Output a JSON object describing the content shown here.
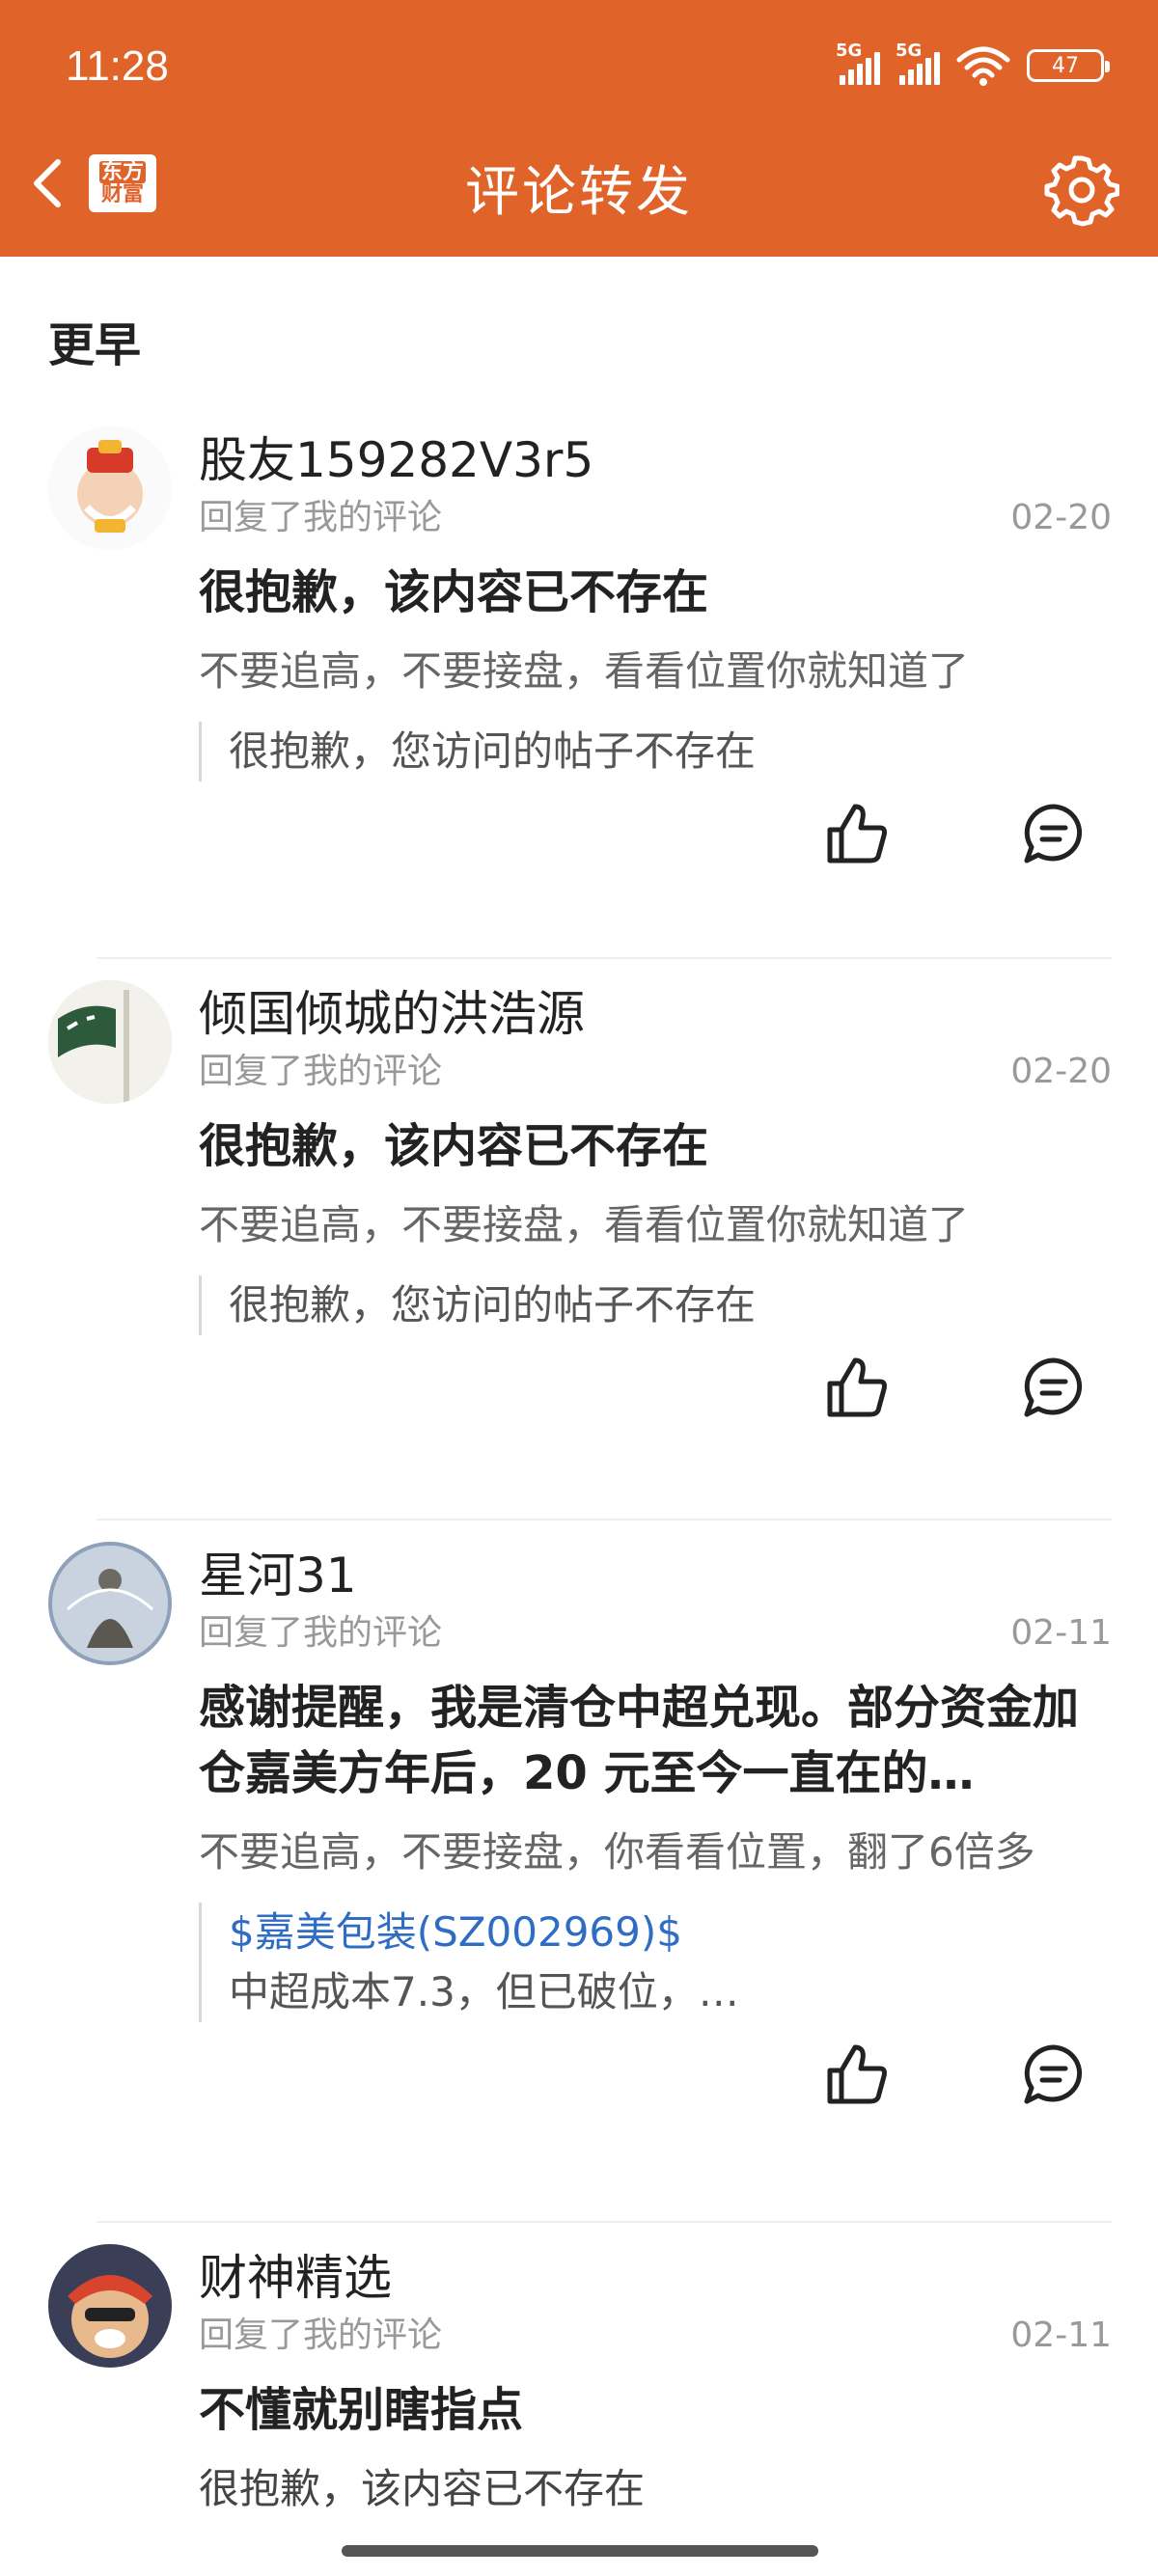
{
  "status_bar": {
    "time": "11:28",
    "net1": "5G",
    "net2": "5G",
    "wifi_tag": "6",
    "battery": "47"
  },
  "header": {
    "logo_line1": "东方",
    "logo_line2": "财富",
    "title": "评论转发",
    "accent": "#e0632a"
  },
  "section": {
    "title": "更早"
  },
  "items": [
    {
      "name": "股友159282V3r5",
      "action": "回复了我的评论",
      "date": "02-20",
      "message": " 很抱歉，该内容已不存在",
      "reference": "不要追高，不要接盘，看看位置你就知道了",
      "quote": "很抱歉，您访问的帖子不存在"
    },
    {
      "name": "倾国倾城的洪浩源",
      "action": "回复了我的评论",
      "date": "02-20",
      "message": " 很抱歉，该内容已不存在",
      "reference": "不要追高，不要接盘，看看位置你就知道了",
      "quote": "很抱歉，您访问的帖子不存在"
    },
    {
      "name": "星河31",
      "action": "回复了我的评论",
      "date": "02-11",
      "message": "感谢提醒，我是清仓中超兑现。部分资金加仓嘉美方年后，20 元至今一直在的…",
      "reference": "不要追高，不要接盘，你看看位置，翻了6倍多",
      "quote_stock": "$嘉美包装(SZ002969)$",
      "quote": "中超成本7.3，但已破位，…"
    },
    {
      "name": "财神精选",
      "action": "回复了我的评论",
      "date": "02-11",
      "message": "不懂就别瞎指点",
      "reference": " 很抱歉，该内容已不存在"
    }
  ]
}
